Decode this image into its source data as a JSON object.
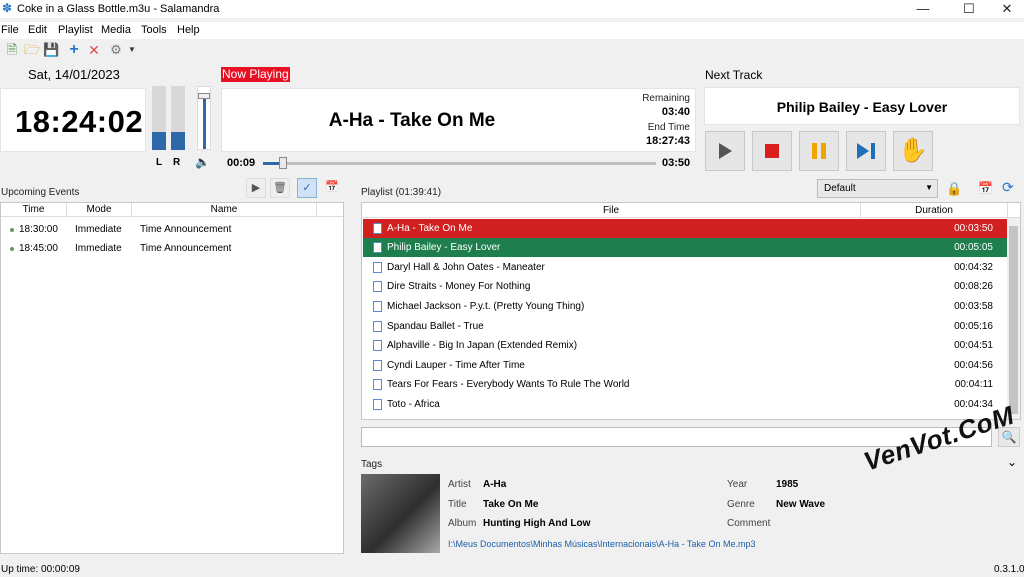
{
  "window": {
    "title": "Coke in a Glass Bottle.m3u - Salamandra"
  },
  "menu": [
    "File",
    "Edit",
    "Playlist",
    "Media",
    "Tools",
    "Help"
  ],
  "header": {
    "date": "Sat, 14/01/2023",
    "clock": "18:24:02",
    "meter_labels": {
      "left": "L",
      "right": "R"
    },
    "meter_levels": {
      "left": 0.28,
      "right": 0.28,
      "volume": 0.9
    },
    "now_playing_label": "Now Playing",
    "now_playing_title": "A-Ha - Take On Me",
    "remaining_label": "Remaining",
    "remaining_value": "03:40",
    "end_time_label": "End Time",
    "end_time_value": "18:27:43",
    "elapsed": "00:09",
    "total": "03:50",
    "progress": 0.04,
    "next_track_label": "Next Track",
    "next_track_title": "Philip Bailey - Easy Lover"
  },
  "events": {
    "title": "Upcoming Events",
    "columns": [
      "Time",
      "Mode",
      "Name"
    ],
    "rows": [
      {
        "time": "18:30:00",
        "mode": "Immediate",
        "name": "Time Announcement"
      },
      {
        "time": "18:45:00",
        "mode": "Immediate",
        "name": "Time Announcement"
      }
    ]
  },
  "playlist": {
    "title": "Playlist (01:39:41)",
    "profile": "Default",
    "columns": [
      "File",
      "Duration"
    ],
    "rows": [
      {
        "file": "A-Ha - Take On Me",
        "duration": "00:03:50"
      },
      {
        "file": "Philip Bailey - Easy Lover",
        "duration": "00:05:05"
      },
      {
        "file": "Daryl Hall & John Oates - Maneater",
        "duration": "00:04:32"
      },
      {
        "file": "Dire Straits - Money For Nothing",
        "duration": "00:08:26"
      },
      {
        "file": "Michael Jackson - P.y.t. (Pretty Young Thing)",
        "duration": "00:03:58"
      },
      {
        "file": "Spandau Ballet - True",
        "duration": "00:05:16"
      },
      {
        "file": "Alphaville - Big In Japan (Extended Remix)",
        "duration": "00:04:51"
      },
      {
        "file": "Cyndi Lauper - Time After Time",
        "duration": "00:04:56"
      },
      {
        "file": "Tears For Fears - Everybody Wants To Rule The World",
        "duration": "00:04:11"
      },
      {
        "file": "Toto - Africa",
        "duration": "00:04:34"
      }
    ]
  },
  "tags": {
    "title": "Tags",
    "artist_label": "Artist",
    "artist": "A-Ha",
    "title_label": "Title",
    "track_title": "Take On Me",
    "album_label": "Album",
    "album": "Hunting High And Low",
    "year_label": "Year",
    "year": "1985",
    "genre_label": "Genre",
    "genre": "New Wave",
    "comment_label": "Comment",
    "path": "I:\\Meus Documentos\\Minhas Músicas\\Internacionais\\A-Ha - Take On Me.mp3"
  },
  "status": {
    "uptime": "Up time: 00:00:09",
    "version": "0.3.1.0"
  },
  "watermark": "VenVot.CoM",
  "colors": {
    "current": "#d02020",
    "next": "#1e7e4e",
    "badge": "#e81123",
    "accent": "#2f68a8"
  }
}
